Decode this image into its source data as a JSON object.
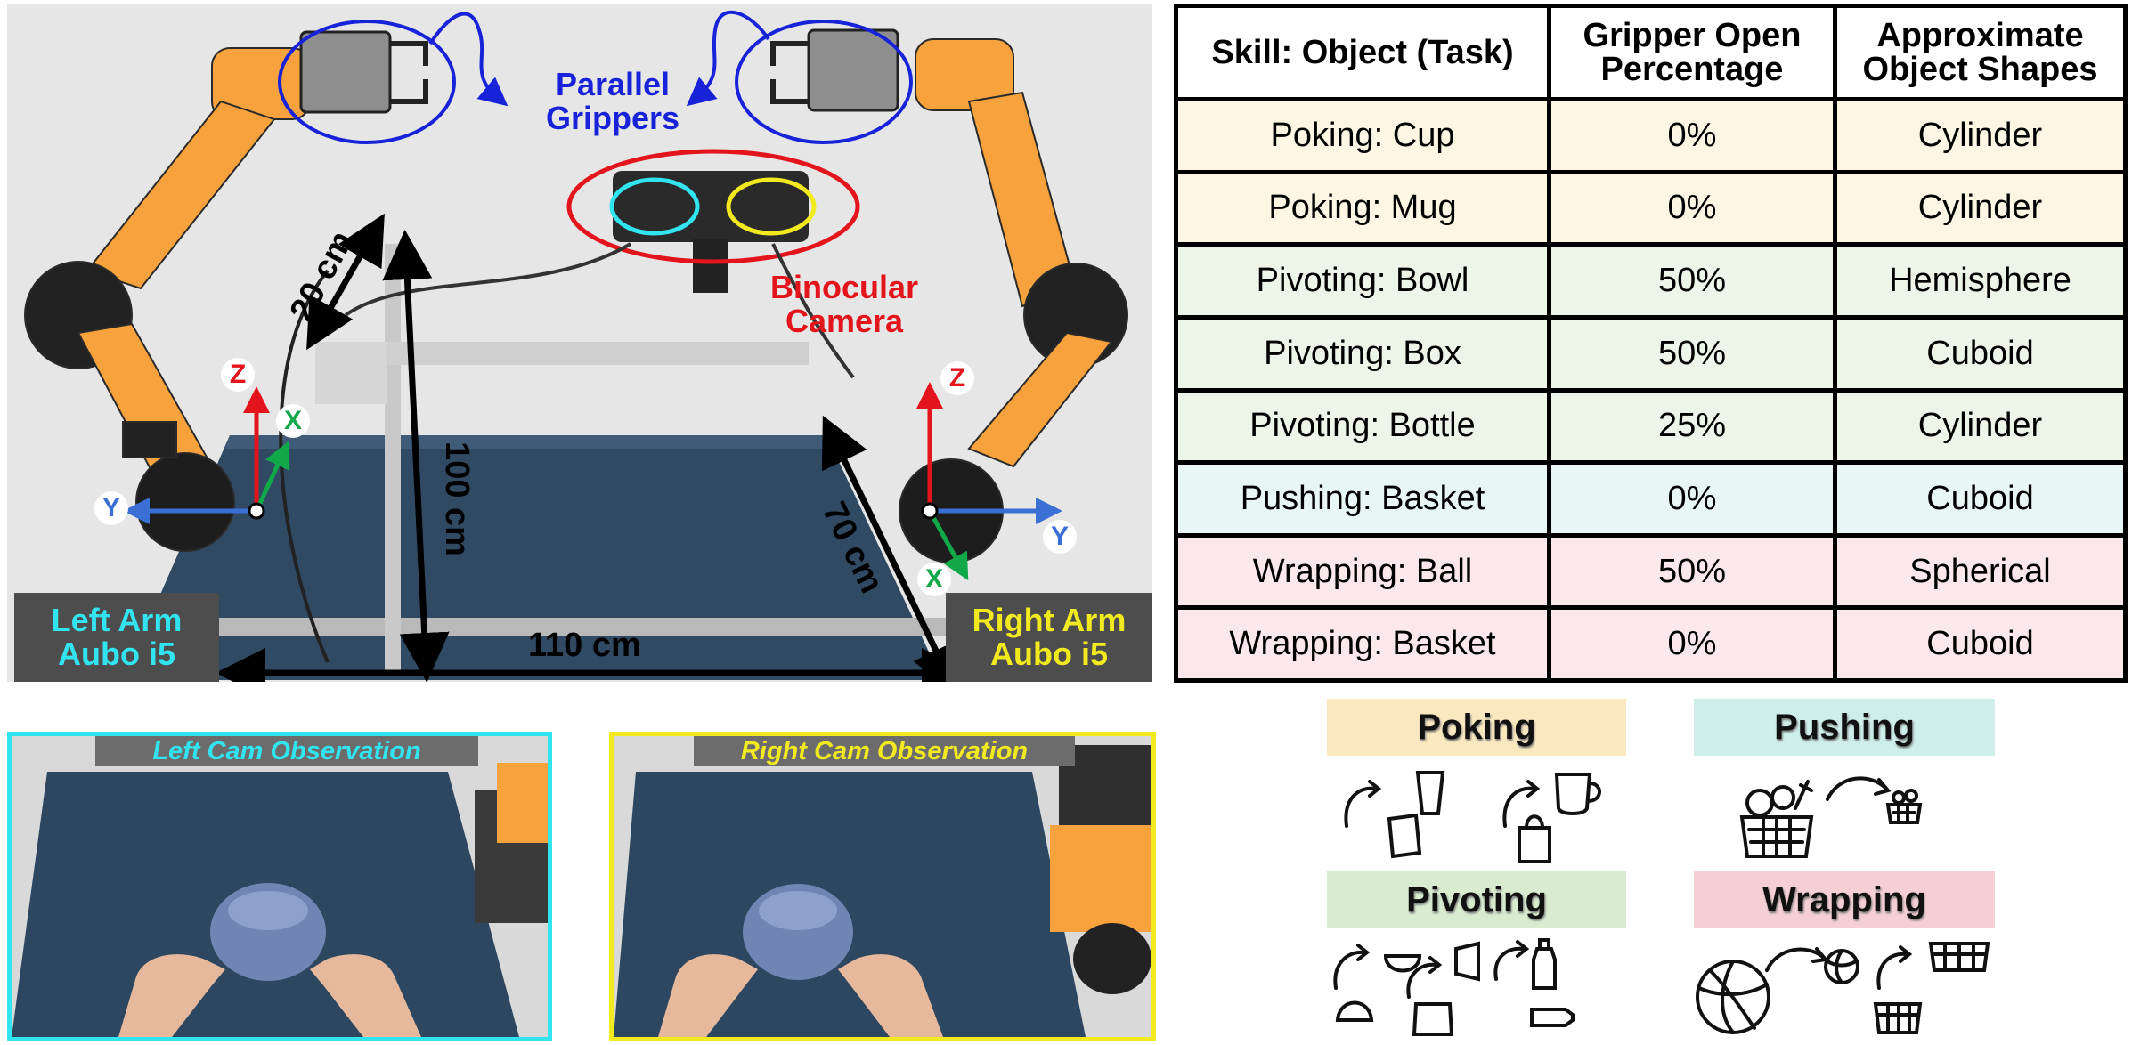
{
  "setup": {
    "grippers_label": "Parallel\nGrippers",
    "camera_label": "Binocular\nCamera",
    "dim_20": "20 cm",
    "dim_100": "100 cm",
    "dim_70": "70 cm",
    "dim_110": "110 cm",
    "left_arm": "Left Arm\nAubo i5",
    "right_arm": "Right Arm\nAubo i5",
    "axes": {
      "z": "Z",
      "x": "X",
      "y": "Y"
    },
    "colors": {
      "arm": "#f7a23c",
      "grippers": "#1722d9",
      "camera": "#e3141b",
      "left_cam": "#31e4f0",
      "right_cam": "#f2ea1f",
      "axis_z": "#e3141b",
      "axis_x": "#11a84a",
      "axis_y": "#3a6fd6"
    }
  },
  "table": {
    "headers": [
      "Skill: Object (Task)",
      "Gripper Open\nPercentage",
      "Approximate\nObject Shapes"
    ],
    "rows": [
      {
        "task": "Poking: Cup",
        "open": "0%",
        "shape": "Cylinder",
        "color": "#fdf6e4"
      },
      {
        "task": "Poking: Mug",
        "open": "0%",
        "shape": "Cylinder",
        "color": "#fdf6e4"
      },
      {
        "task": "Pivoting: Bowl",
        "open": "50%",
        "shape": "Hemisphere",
        "color": "#edf5e8"
      },
      {
        "task": "Pivoting: Box",
        "open": "50%",
        "shape": "Cuboid",
        "color": "#edf5e8"
      },
      {
        "task": "Pivoting: Bottle",
        "open": "25%",
        "shape": "Cylinder",
        "color": "#edf5e8"
      },
      {
        "task": "Pushing: Basket",
        "open": "0%",
        "shape": "Cuboid",
        "color": "#e8f7f5"
      },
      {
        "task": "Wrapping: Ball",
        "open": "50%",
        "shape": "Spherical",
        "color": "#fbe8ea"
      },
      {
        "task": "Wrapping: Basket",
        "open": "0%",
        "shape": "Cuboid",
        "color": "#fbe8ea"
      }
    ]
  },
  "cams": {
    "left_title": "Left Cam Observation",
    "right_title": "Right Cam Observation",
    "left_color": "#31e4f0",
    "right_color": "#f2ea1f"
  },
  "skills": {
    "poking": {
      "label": "Poking",
      "color": "#fae8bf"
    },
    "pushing": {
      "label": "Pushing",
      "color": "#cdeee9"
    },
    "pivoting": {
      "label": "Pivoting",
      "color": "#d9ecd0"
    },
    "wrapping": {
      "label": "Wrapping",
      "color": "#f6cfd6"
    }
  }
}
